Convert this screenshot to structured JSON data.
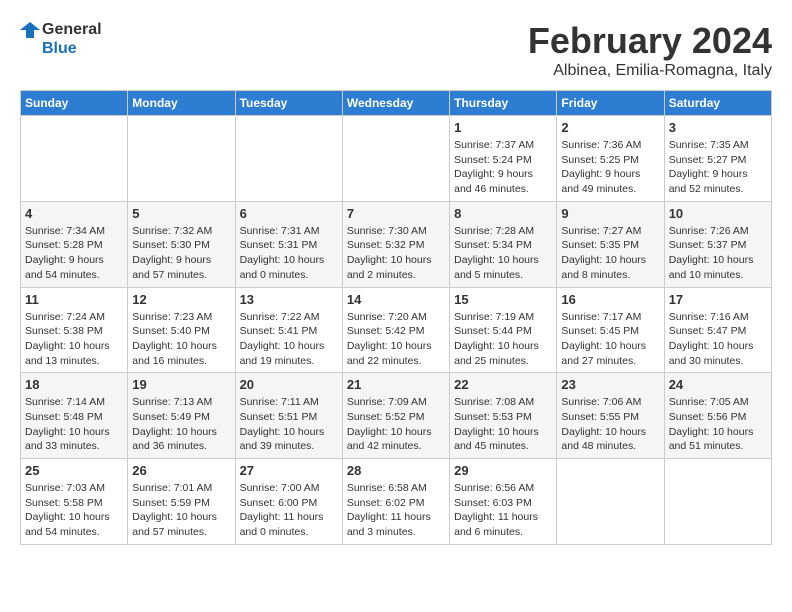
{
  "logo": {
    "text_general": "General",
    "text_blue": "Blue"
  },
  "header": {
    "month": "February 2024",
    "location": "Albinea, Emilia-Romagna, Italy"
  },
  "weekdays": [
    "Sunday",
    "Monday",
    "Tuesday",
    "Wednesday",
    "Thursday",
    "Friday",
    "Saturday"
  ],
  "weeks": [
    [
      {
        "num": "",
        "info": ""
      },
      {
        "num": "",
        "info": ""
      },
      {
        "num": "",
        "info": ""
      },
      {
        "num": "",
        "info": ""
      },
      {
        "num": "1",
        "info": "Sunrise: 7:37 AM\nSunset: 5:24 PM\nDaylight: 9 hours\nand 46 minutes."
      },
      {
        "num": "2",
        "info": "Sunrise: 7:36 AM\nSunset: 5:25 PM\nDaylight: 9 hours\nand 49 minutes."
      },
      {
        "num": "3",
        "info": "Sunrise: 7:35 AM\nSunset: 5:27 PM\nDaylight: 9 hours\nand 52 minutes."
      }
    ],
    [
      {
        "num": "4",
        "info": "Sunrise: 7:34 AM\nSunset: 5:28 PM\nDaylight: 9 hours\nand 54 minutes."
      },
      {
        "num": "5",
        "info": "Sunrise: 7:32 AM\nSunset: 5:30 PM\nDaylight: 9 hours\nand 57 minutes."
      },
      {
        "num": "6",
        "info": "Sunrise: 7:31 AM\nSunset: 5:31 PM\nDaylight: 10 hours\nand 0 minutes."
      },
      {
        "num": "7",
        "info": "Sunrise: 7:30 AM\nSunset: 5:32 PM\nDaylight: 10 hours\nand 2 minutes."
      },
      {
        "num": "8",
        "info": "Sunrise: 7:28 AM\nSunset: 5:34 PM\nDaylight: 10 hours\nand 5 minutes."
      },
      {
        "num": "9",
        "info": "Sunrise: 7:27 AM\nSunset: 5:35 PM\nDaylight: 10 hours\nand 8 minutes."
      },
      {
        "num": "10",
        "info": "Sunrise: 7:26 AM\nSunset: 5:37 PM\nDaylight: 10 hours\nand 10 minutes."
      }
    ],
    [
      {
        "num": "11",
        "info": "Sunrise: 7:24 AM\nSunset: 5:38 PM\nDaylight: 10 hours\nand 13 minutes."
      },
      {
        "num": "12",
        "info": "Sunrise: 7:23 AM\nSunset: 5:40 PM\nDaylight: 10 hours\nand 16 minutes."
      },
      {
        "num": "13",
        "info": "Sunrise: 7:22 AM\nSunset: 5:41 PM\nDaylight: 10 hours\nand 19 minutes."
      },
      {
        "num": "14",
        "info": "Sunrise: 7:20 AM\nSunset: 5:42 PM\nDaylight: 10 hours\nand 22 minutes."
      },
      {
        "num": "15",
        "info": "Sunrise: 7:19 AM\nSunset: 5:44 PM\nDaylight: 10 hours\nand 25 minutes."
      },
      {
        "num": "16",
        "info": "Sunrise: 7:17 AM\nSunset: 5:45 PM\nDaylight: 10 hours\nand 27 minutes."
      },
      {
        "num": "17",
        "info": "Sunrise: 7:16 AM\nSunset: 5:47 PM\nDaylight: 10 hours\nand 30 minutes."
      }
    ],
    [
      {
        "num": "18",
        "info": "Sunrise: 7:14 AM\nSunset: 5:48 PM\nDaylight: 10 hours\nand 33 minutes."
      },
      {
        "num": "19",
        "info": "Sunrise: 7:13 AM\nSunset: 5:49 PM\nDaylight: 10 hours\nand 36 minutes."
      },
      {
        "num": "20",
        "info": "Sunrise: 7:11 AM\nSunset: 5:51 PM\nDaylight: 10 hours\nand 39 minutes."
      },
      {
        "num": "21",
        "info": "Sunrise: 7:09 AM\nSunset: 5:52 PM\nDaylight: 10 hours\nand 42 minutes."
      },
      {
        "num": "22",
        "info": "Sunrise: 7:08 AM\nSunset: 5:53 PM\nDaylight: 10 hours\nand 45 minutes."
      },
      {
        "num": "23",
        "info": "Sunrise: 7:06 AM\nSunset: 5:55 PM\nDaylight: 10 hours\nand 48 minutes."
      },
      {
        "num": "24",
        "info": "Sunrise: 7:05 AM\nSunset: 5:56 PM\nDaylight: 10 hours\nand 51 minutes."
      }
    ],
    [
      {
        "num": "25",
        "info": "Sunrise: 7:03 AM\nSunset: 5:58 PM\nDaylight: 10 hours\nand 54 minutes."
      },
      {
        "num": "26",
        "info": "Sunrise: 7:01 AM\nSunset: 5:59 PM\nDaylight: 10 hours\nand 57 minutes."
      },
      {
        "num": "27",
        "info": "Sunrise: 7:00 AM\nSunset: 6:00 PM\nDaylight: 11 hours\nand 0 minutes."
      },
      {
        "num": "28",
        "info": "Sunrise: 6:58 AM\nSunset: 6:02 PM\nDaylight: 11 hours\nand 3 minutes."
      },
      {
        "num": "29",
        "info": "Sunrise: 6:56 AM\nSunset: 6:03 PM\nDaylight: 11 hours\nand 6 minutes."
      },
      {
        "num": "",
        "info": ""
      },
      {
        "num": "",
        "info": ""
      }
    ]
  ]
}
